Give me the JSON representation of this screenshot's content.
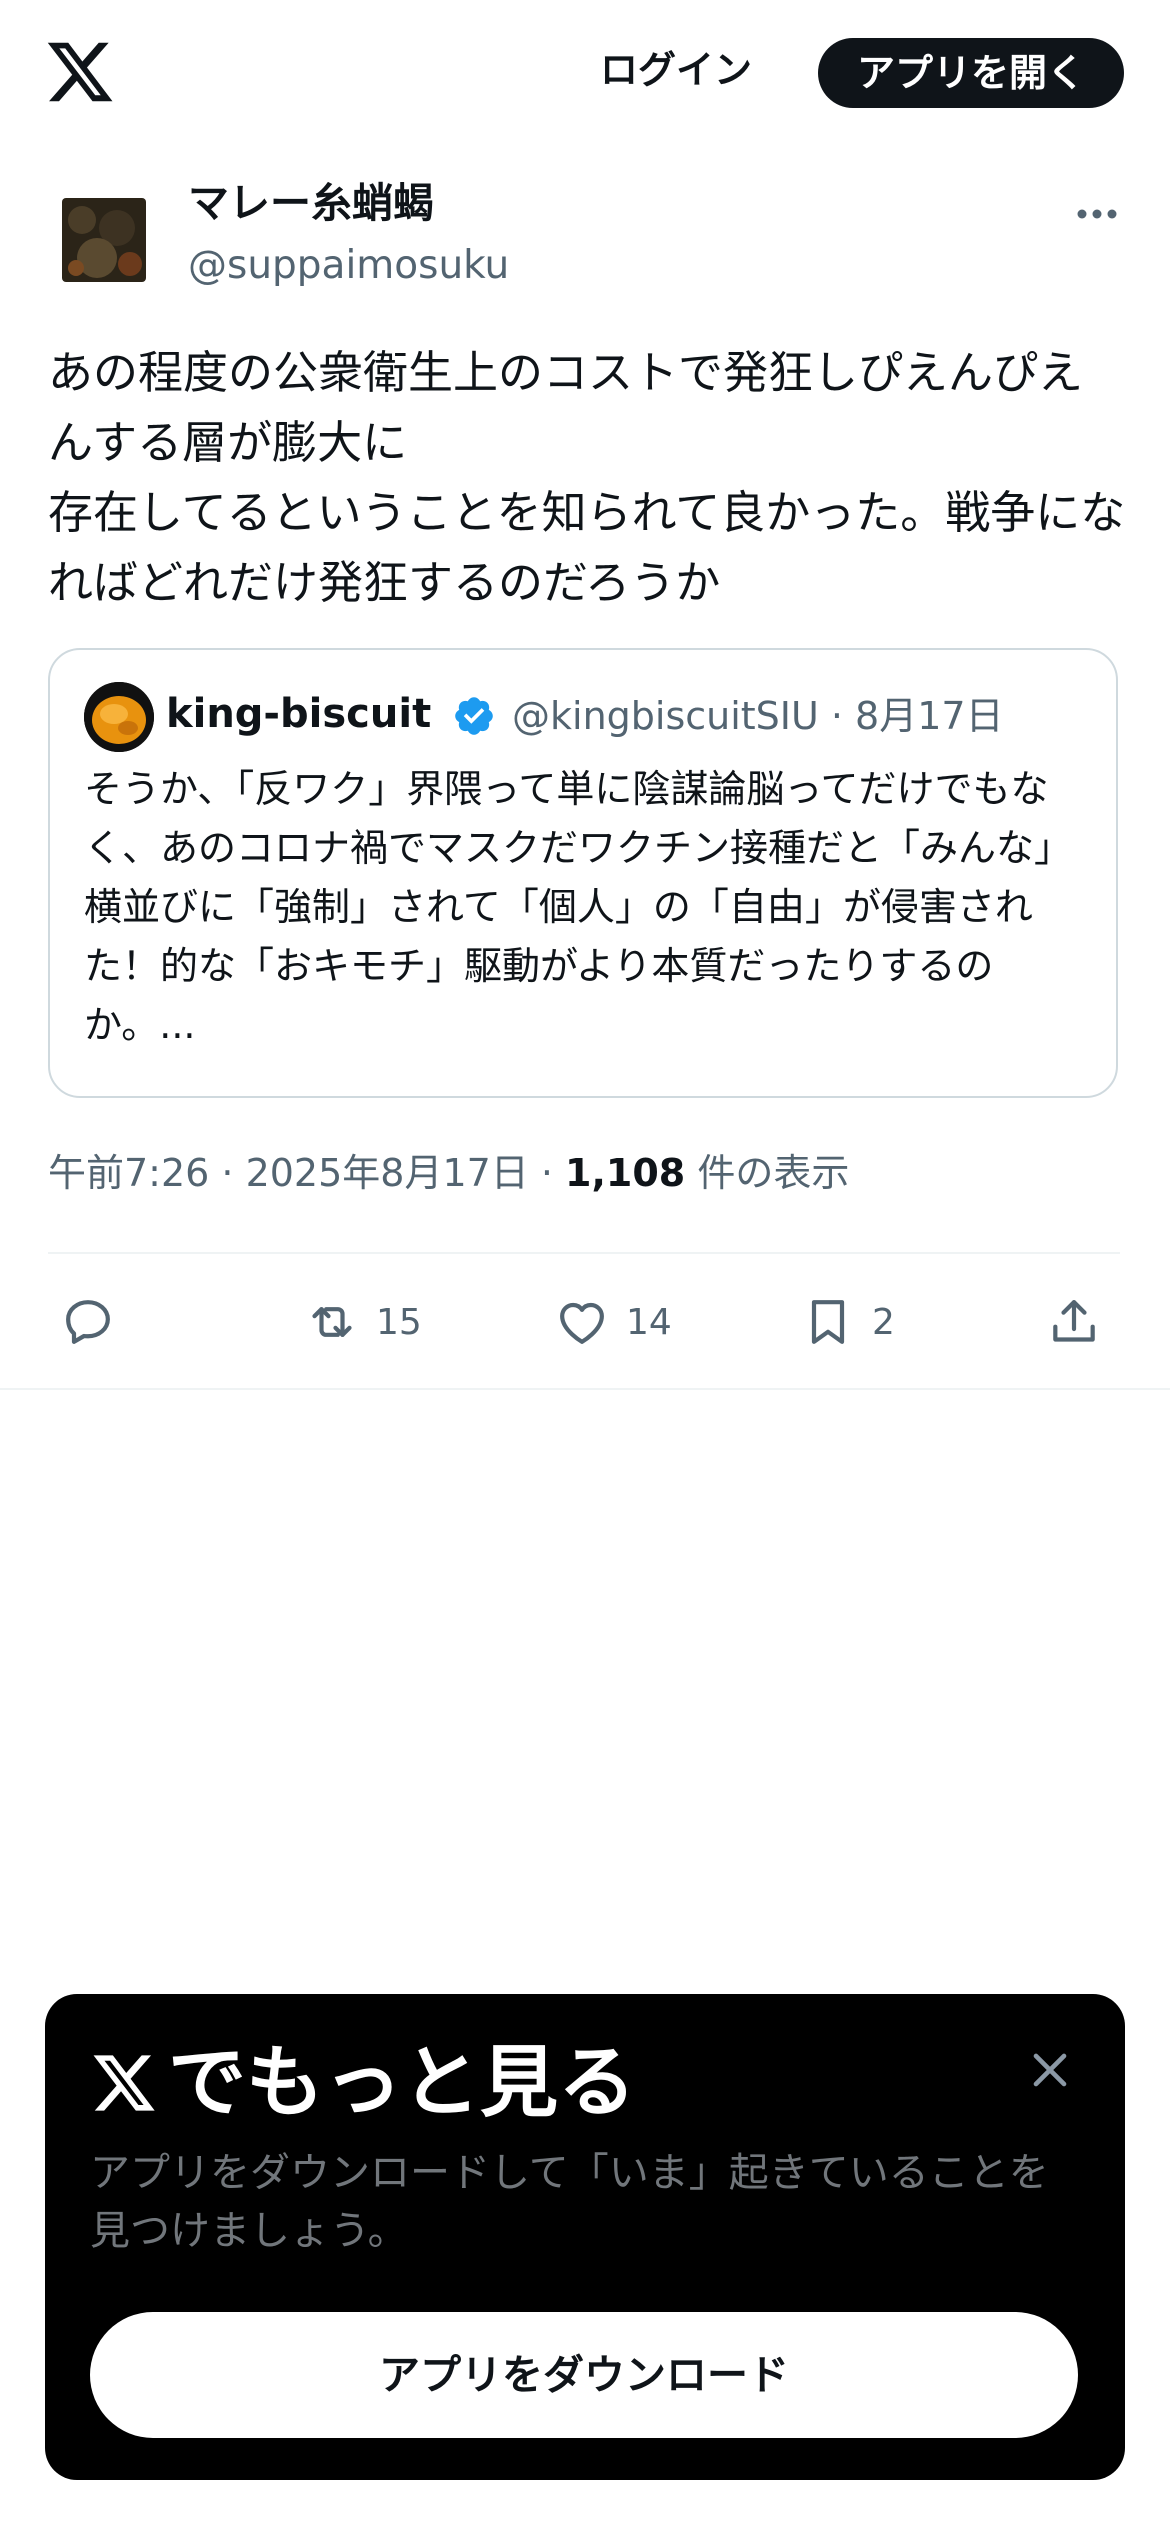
{
  "header": {
    "login_label": "ログイン",
    "open_app_label": "アプリを開く"
  },
  "tweet": {
    "author_name": "マレー糸蛸蝎",
    "author_handle": "@suppaimosuku",
    "text": "あの程度の公衆衛生上のコストで発狂しぴえんぴえんする層が膨大に\n存在してるということを知られて良かった。戦争になればどれだけ発狂するのだろうか",
    "meta": {
      "time": "午前7:26 · 2025年8月17日 · ",
      "views_count": "1,108",
      "views_label": " 件の表示"
    }
  },
  "quote": {
    "author_name": "king-biscuit",
    "handle_and_date": "@kingbiscuitSIU · 8月17日",
    "text": "そうか、「反ワク」界隈って単に陰謀論脳ってだけでもなく、あのコロナ禍でマスクだワクチン接種だと「みんな」横並びに「強制」されて「個人」の「自由」が侵害された！的な「おキモチ」駆動がより本質だったりするのか。..."
  },
  "actions": {
    "reply_count": "",
    "retweet_count": "15",
    "like_count": "14",
    "bookmark_count": "2"
  },
  "promo": {
    "title": "でもっと見る",
    "description": "アプリをダウンロードして「いま」起きていることを見つけましょう。",
    "download_label": "アプリをダウンロード"
  },
  "colors": {
    "text": "#0f1419",
    "secondary": "#536471",
    "border": "#cfd9de",
    "verified": "#1d9bf0",
    "promo_bg": "#000000"
  },
  "icons": [
    "x-logo-icon",
    "more-icon",
    "verified-icon",
    "reply-icon",
    "retweet-icon",
    "like-icon",
    "bookmark-icon",
    "share-icon",
    "close-icon"
  ]
}
